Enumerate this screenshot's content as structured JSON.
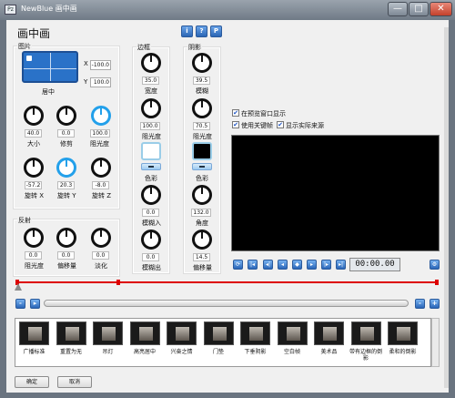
{
  "window": {
    "title": "NewBlue 画中画",
    "app_icon": "Pz"
  },
  "title_buttons": {
    "minimize": "—",
    "maximize": "□",
    "close": "✕"
  },
  "panel": {
    "heading": "画中画",
    "info_btn": "i",
    "help_btn": "?",
    "preset_btn": "P"
  },
  "picture": {
    "label": "图片",
    "position_label": "居中",
    "x_label": "X",
    "x_value": "-100.0",
    "y_label": "Y",
    "y_value": "100.0",
    "size": {
      "value": "40.0",
      "label": "大小"
    },
    "crop": {
      "value": "0.0",
      "label": "修剪"
    },
    "opacity": {
      "value": "100.0",
      "label": "阻光度"
    },
    "rot_x": {
      "value": "-57.2",
      "label": "旋转 X"
    },
    "rot_y": {
      "value": "20.3",
      "label": "旋转 Y"
    },
    "rot_z": {
      "value": "-8.0",
      "label": "旋转 Z"
    }
  },
  "reflection": {
    "label": "反射",
    "opacity": {
      "value": "0.0",
      "label": "阻光度"
    },
    "offset": {
      "value": "0.0",
      "label": "偏移量"
    },
    "fade": {
      "value": "0.0",
      "label": "淡化"
    }
  },
  "border": {
    "label": "边框",
    "width": {
      "value": "35.0",
      "label": "宽度"
    },
    "opacity": {
      "value": "100.0",
      "label": "阻光度"
    },
    "color_label": "色彩",
    "color": "#ffffff",
    "blur_in": {
      "value": "0.0",
      "label": "模糊入"
    },
    "blur_out": {
      "value": "0.0",
      "label": "模糊出"
    }
  },
  "shadow": {
    "label": "阴影",
    "blur": {
      "value": "39.5",
      "label": "模糊"
    },
    "opacity": {
      "value": "70.5",
      "label": "阻光度"
    },
    "color_label": "色彩",
    "color": "#000000",
    "angle": {
      "value": "132.0",
      "label": "角度"
    },
    "offset": {
      "value": "14.5",
      "label": "偏移量"
    }
  },
  "options": {
    "show_in_preview": "在预览窗口显示",
    "use_keyframes": "使用关键帧",
    "show_actual_source": "显示实际来源"
  },
  "transport": {
    "timecode": "00:00.00"
  },
  "presets": [
    {
      "label": "广播标准"
    },
    {
      "label": "重置为无"
    },
    {
      "label": "吊灯"
    },
    {
      "label": "高亮居中"
    },
    {
      "label": "兴奋之情"
    },
    {
      "label": "门垫"
    },
    {
      "label": "下垂阴影"
    },
    {
      "label": "空白帧"
    },
    {
      "label": "美术品"
    },
    {
      "label": "带有边框的倒影"
    },
    {
      "label": "柔和的倒影"
    }
  ],
  "footer": {
    "ok": "确定",
    "cancel": "取消"
  },
  "colors": {
    "accent_knob": "#23a0ea",
    "timeline": "#dd0000",
    "titlebar": "#7d8894"
  }
}
